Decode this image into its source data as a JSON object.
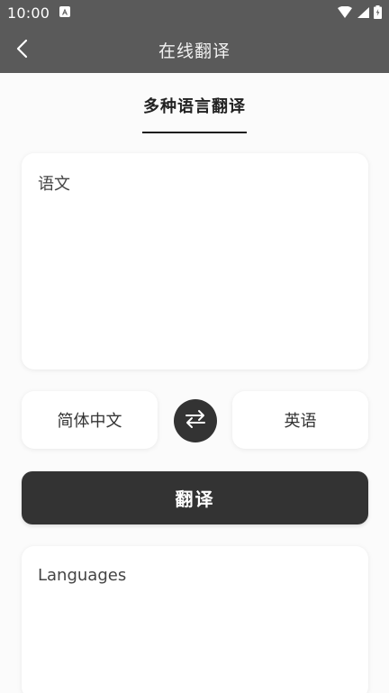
{
  "status_bar": {
    "time": "10:00"
  },
  "app_bar": {
    "title": "在线翻译"
  },
  "tab": {
    "label": "多种语言翻译"
  },
  "source_card": {
    "text": "语文"
  },
  "languages": {
    "source": "简体中文",
    "target": "英语"
  },
  "translate_button": {
    "label": "翻译"
  },
  "result_card": {
    "text": "Languages"
  },
  "colors": {
    "app_bar": "#5a5a5a",
    "primary_dark": "#333333",
    "background": "#fbfbfb"
  },
  "icons": {
    "back": "chevron-left-icon",
    "swap": "swap-arrows-icon",
    "wifi": "wifi-icon",
    "signal": "signal-icon",
    "battery": "battery-icon",
    "notification": "notification-a-icon"
  }
}
